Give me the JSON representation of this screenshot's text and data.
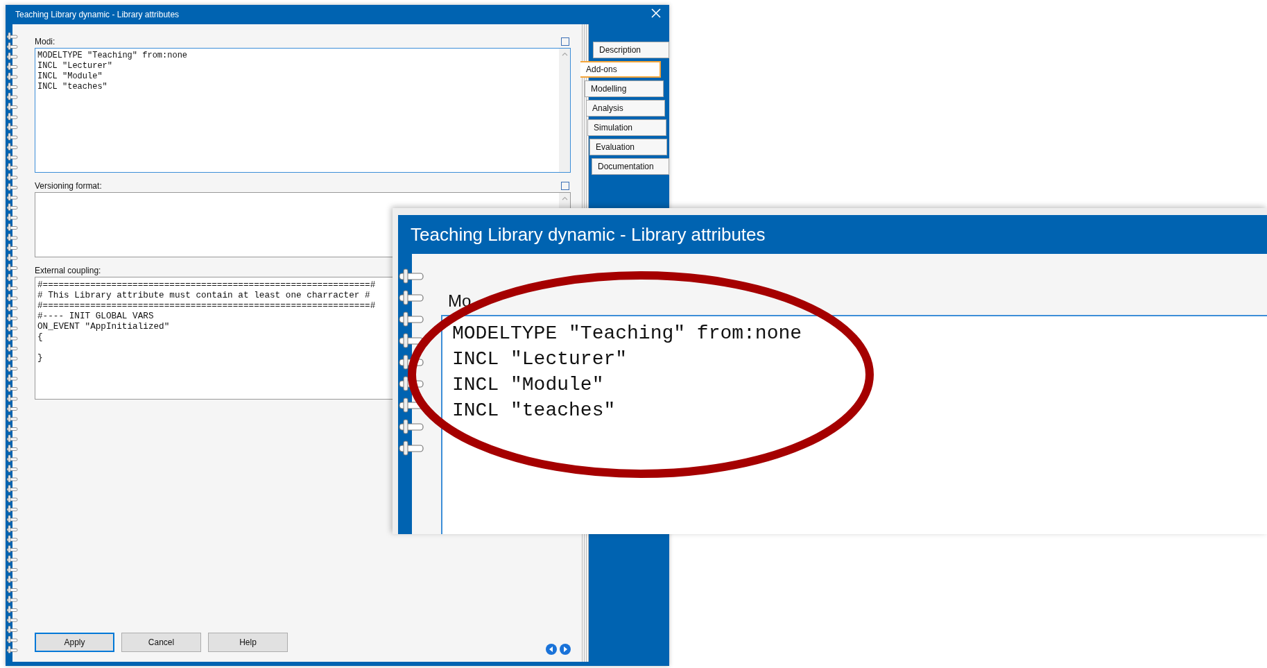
{
  "dialog": {
    "title": "Teaching Library dynamic - Library attributes"
  },
  "fields": [
    {
      "label": "Modi:",
      "maximize": true,
      "scrollbar": true,
      "lines": [
        "MODELTYPE \"Teaching\" from:none",
        "INCL \"Lecturer\"",
        "INCL \"Module\"",
        "INCL \"teaches\""
      ]
    },
    {
      "label": "Versioning format:",
      "maximize": true,
      "scrollbar": true
    },
    {
      "label": "External coupling:",
      "maximize": false,
      "scrollbar": false,
      "lines": [
        "#==============================================================#",
        "# This Library attribute must contain at least one charracter #",
        "#==============================================================#",
        "#---- INIT GLOBAL VARS",
        "ON_EVENT \"AppInitialized\"",
        "{\n\n}"
      ]
    }
  ],
  "buttons": [
    {
      "label": "Apply",
      "default": true
    },
    {
      "label": "Cancel",
      "default": false
    },
    {
      "label": "Help",
      "default": false
    }
  ],
  "tabs": [
    {
      "label": "Description",
      "selected": false
    },
    {
      "label": "Add-ons",
      "selected": true
    },
    {
      "label": "Modelling",
      "selected": false
    },
    {
      "label": "Analysis",
      "selected": false
    },
    {
      "label": "Simulation",
      "selected": false
    },
    {
      "label": "Evaluation",
      "selected": false
    },
    {
      "label": "Documentation",
      "selected": false
    }
  ],
  "zoom_inset": {
    "title": "Teaching Library dynamic - Library attributes",
    "label": "Mo",
    "lines": [
      "MODELTYPE \"Teaching\" from:none",
      "INCL \"Lecturer\"",
      "INCL \"Module\"",
      "INCL \"teaches\""
    ]
  }
}
